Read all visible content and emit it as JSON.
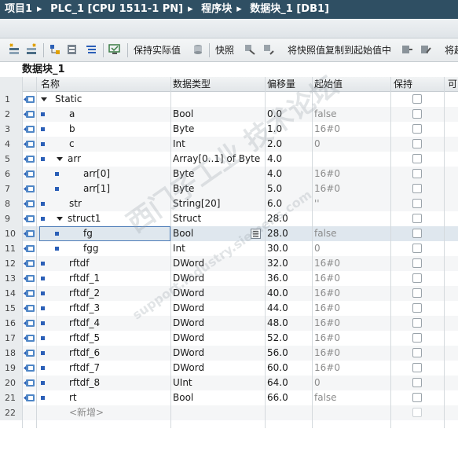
{
  "breadcrumb": [
    "项目1",
    "PLC_1 [CPU 1511-1 PN]",
    "程序块",
    "数据块_1 [DB1]"
  ],
  "toolbar": {
    "keep_actual": "保持实际值",
    "snapshot": "快照",
    "copy_snapshot": "将快照值复制到起始值中",
    "truncated": "将起"
  },
  "block_title": "数据块_1",
  "columns": {
    "name": "名称",
    "type": "数据类型",
    "offset": "偏移量",
    "start": "起始值",
    "retain": "保持",
    "extra": "可"
  },
  "rows": [
    {
      "n": "1",
      "name": "Static",
      "type": "",
      "offset": "",
      "start": "",
      "level": 0,
      "expand": true,
      "icon": "tri",
      "db": true
    },
    {
      "n": "2",
      "name": "a",
      "type": "Bool",
      "offset": "0.0",
      "start": "false",
      "level": 1,
      "icon": "sq",
      "db": true
    },
    {
      "n": "3",
      "name": "b",
      "type": "Byte",
      "offset": "1.0",
      "start": "16#0",
      "level": 1,
      "icon": "sq",
      "db": true
    },
    {
      "n": "4",
      "name": "c",
      "type": "Int",
      "offset": "2.0",
      "start": "0",
      "level": 1,
      "icon": "sq",
      "db": true
    },
    {
      "n": "5",
      "name": "arr",
      "type": "Array[0..1] of Byte",
      "offset": "4.0",
      "start": "",
      "level": 1,
      "expand": true,
      "icon": "sq",
      "db": true
    },
    {
      "n": "6",
      "name": "arr[0]",
      "type": "Byte",
      "offset": "4.0",
      "start": "16#0",
      "level": 2,
      "icon": "sq",
      "db": true,
      "sub": true
    },
    {
      "n": "7",
      "name": "arr[1]",
      "type": "Byte",
      "offset": "5.0",
      "start": "16#0",
      "level": 2,
      "icon": "sq",
      "db": true,
      "sub": true
    },
    {
      "n": "8",
      "name": "str",
      "type": "String[20]",
      "offset": "6.0",
      "start": "''",
      "level": 1,
      "icon": "sq",
      "db": true
    },
    {
      "n": "9",
      "name": "struct1",
      "type": "Struct",
      "offset": "28.0",
      "start": "",
      "level": 1,
      "expand": true,
      "icon": "sq",
      "db": true
    },
    {
      "n": "10",
      "name": "fg",
      "type": "Bool",
      "offset": "28.0",
      "start": "false",
      "level": 2,
      "icon": "sq",
      "db": true,
      "selected": true
    },
    {
      "n": "11",
      "name": "fgg",
      "type": "Int",
      "offset": "30.0",
      "start": "0",
      "level": 2,
      "icon": "sq",
      "db": true
    },
    {
      "n": "12",
      "name": "rftdf",
      "type": "DWord",
      "offset": "32.0",
      "start": "16#0",
      "level": 1,
      "icon": "sq",
      "db": true
    },
    {
      "n": "13",
      "name": "rftdf_1",
      "type": "DWord",
      "offset": "36.0",
      "start": "16#0",
      "level": 1,
      "icon": "sq",
      "db": true
    },
    {
      "n": "14",
      "name": "rftdf_2",
      "type": "DWord",
      "offset": "40.0",
      "start": "16#0",
      "level": 1,
      "icon": "sq",
      "db": true
    },
    {
      "n": "15",
      "name": "rftdf_3",
      "type": "DWord",
      "offset": "44.0",
      "start": "16#0",
      "level": 1,
      "icon": "sq",
      "db": true
    },
    {
      "n": "16",
      "name": "rftdf_4",
      "type": "DWord",
      "offset": "48.0",
      "start": "16#0",
      "level": 1,
      "icon": "sq",
      "db": true
    },
    {
      "n": "17",
      "name": "rftdf_5",
      "type": "DWord",
      "offset": "52.0",
      "start": "16#0",
      "level": 1,
      "icon": "sq",
      "db": true
    },
    {
      "n": "18",
      "name": "rftdf_6",
      "type": "DWord",
      "offset": "56.0",
      "start": "16#0",
      "level": 1,
      "icon": "sq",
      "db": true
    },
    {
      "n": "19",
      "name": "rftdf_7",
      "type": "DWord",
      "offset": "60.0",
      "start": "16#0",
      "level": 1,
      "icon": "sq",
      "db": true
    },
    {
      "n": "20",
      "name": "rftdf_8",
      "type": "UInt",
      "offset": "64.0",
      "start": "0",
      "level": 1,
      "icon": "sq",
      "db": true
    },
    {
      "n": "21",
      "name": "rt",
      "type": "Bool",
      "offset": "66.0",
      "start": "false",
      "level": 1,
      "icon": "sq",
      "db": true
    },
    {
      "n": "22",
      "name": "<新增>",
      "type": "",
      "offset": "",
      "start": "",
      "level": 1,
      "icon": "none",
      "db": false,
      "placeholder": true
    }
  ],
  "colors": {
    "title_bg": "#2f4f63",
    "accent": "#2b5fb7",
    "selection": "#4d7cb8"
  },
  "watermark": {
    "line1": "西门子工业 技术论坛",
    "line2": "support.industry.siemens.com"
  }
}
